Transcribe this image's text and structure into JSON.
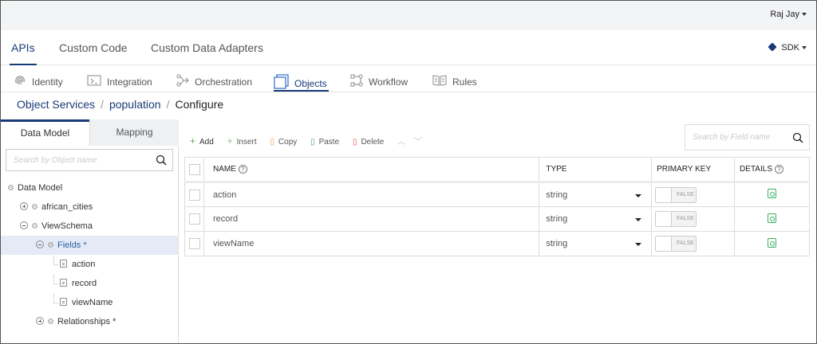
{
  "user": {
    "name": "Raj Jay"
  },
  "main_nav": {
    "tabs": [
      {
        "label": "APIs",
        "active": true
      },
      {
        "label": "Custom Code",
        "active": false
      },
      {
        "label": "Custom Data Adapters",
        "active": false
      }
    ],
    "sdk_label": "SDK"
  },
  "sub_nav": {
    "items": [
      {
        "label": "Identity",
        "icon": "fingerprint-icon"
      },
      {
        "label": "Integration",
        "icon": "integration-icon"
      },
      {
        "label": "Orchestration",
        "icon": "orchestration-icon"
      },
      {
        "label": "Objects",
        "icon": "objects-icon",
        "active": true
      },
      {
        "label": "Workflow",
        "icon": "workflow-icon"
      },
      {
        "label": "Rules",
        "icon": "rules-icon"
      }
    ]
  },
  "breadcrumb": {
    "items": [
      "Object Services",
      "population",
      "Configure"
    ],
    "separator": "/"
  },
  "left_panel": {
    "tabs": [
      "Data Model",
      "Mapping"
    ],
    "search_placeholder": "Search by Object name",
    "tree": {
      "root": "Data Model",
      "african_cities": "african_cities",
      "view_schema": "ViewSchema",
      "fields": "Fields *",
      "field_items": [
        "action",
        "record",
        "viewName"
      ],
      "relationships": "Relationships *"
    }
  },
  "toolbar": {
    "add": "Add",
    "insert": "Insert",
    "copy": "Copy",
    "paste": "Paste",
    "delete": "Delete"
  },
  "grid": {
    "search_placeholder": "Search by Field name",
    "columns": {
      "name": "NAME",
      "type": "TYPE",
      "primary_key": "PRIMARY KEY",
      "details": "DETAILS"
    },
    "rows": [
      {
        "name": "action",
        "type": "string",
        "primary_key": "FALSE"
      },
      {
        "name": "record",
        "type": "string",
        "primary_key": "FALSE"
      },
      {
        "name": "viewName",
        "type": "string",
        "primary_key": "FALSE"
      }
    ]
  },
  "colors": {
    "accent": "#1a3a78",
    "selected_bg": "#e4ebf6",
    "details_icon": "#3ab060",
    "delete_icon": "#e05858",
    "copy_icon": "#f0a030",
    "paste_icon": "#40a860",
    "add_icon": "#5ab05a"
  }
}
